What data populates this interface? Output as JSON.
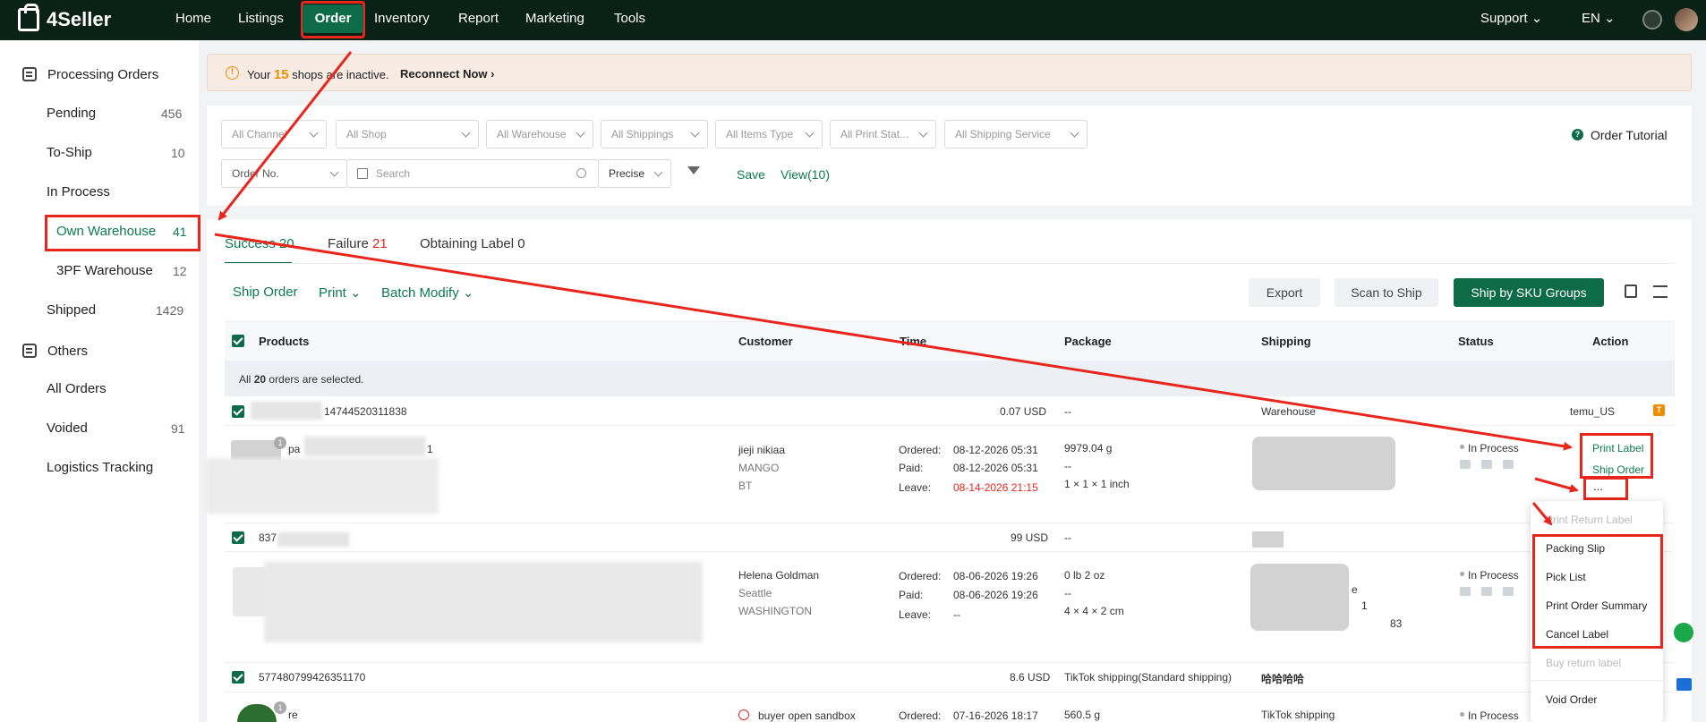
{
  "brand": "4Seller",
  "topnav": {
    "items": [
      "Home",
      "Listings",
      "Order",
      "Inventory",
      "Report",
      "Marketing",
      "Tools"
    ],
    "support": "Support",
    "language": "EN"
  },
  "sidebar": {
    "section1": "Processing Orders",
    "pending": {
      "label": "Pending",
      "count": "456"
    },
    "toship": {
      "label": "To-Ship",
      "count": "10"
    },
    "inprocess": {
      "label": "In Process"
    },
    "ownwh": {
      "label": "Own Warehouse",
      "count": "41"
    },
    "pfwh": {
      "label": "3PF Warehouse",
      "count": "12"
    },
    "shipped": {
      "label": "Shipped",
      "count": "1429"
    },
    "section2": "Others",
    "allorders": "All Orders",
    "voided": {
      "label": "Voided",
      "count": "91"
    },
    "logistics": "Logistics Tracking"
  },
  "notice": {
    "pre": "Your",
    "count": "15",
    "post": "shops are inactive.",
    "link": "Reconnect Now"
  },
  "filters": {
    "channel": "All Channel",
    "shop": "All Shop",
    "warehouse": "All Warehouse",
    "shippings": "All Shippings",
    "items_type": "All Items Type",
    "print_status": "All Print Stat...",
    "shipping_service": "All Shipping Service",
    "order_no": "Order No.",
    "search_placeholder": "Search",
    "precise": "Precise",
    "save": "Save",
    "view": "View(10)",
    "tutorial": "Order Tutorial"
  },
  "tabs": {
    "success_label": "Success",
    "success_count": "20",
    "failure_label": "Failure",
    "failure_count": "21",
    "obtaining_label": "Obtaining Label 0"
  },
  "toolbar": {
    "ship_order": "Ship Order",
    "print": "Print",
    "batch_modify": "Batch Modify",
    "export": "Export",
    "scan_to_ship": "Scan to Ship",
    "ship_by_sku": "Ship by SKU Groups"
  },
  "table": {
    "headers": [
      "Products",
      "Customer",
      "Time",
      "Package",
      "Shipping",
      "Status",
      "Action"
    ],
    "selected_pre": "All",
    "selected_count": "20",
    "selected_post": "orders are selected."
  },
  "orders": [
    {
      "order_no": "14744520311838",
      "amount": "0.07 USD",
      "package_head": "--",
      "shipping_head": "Warehouse",
      "shop": "temu_US",
      "shop_badge": "T",
      "product": "pa",
      "product_tail": "1",
      "customer_name": "jieji nikiaa",
      "customer_city": "MANGO",
      "customer_state": "BT",
      "ordered": "08-12-2026 05:31",
      "paid": "08-12-2026 05:31",
      "leave": "08-14-2026 21:15",
      "pkg_weight": "9979.04 g",
      "pkg_mid": "--",
      "pkg_dims": "1 × 1 × 1 inch",
      "status": "In Process",
      "action1": "Print Label",
      "action2": "Ship Order",
      "more": "..."
    },
    {
      "order_no": "837",
      "amount": "99 USD",
      "package_head": "--",
      "customer_name": "Helena Goldman",
      "customer_city": "Seattle",
      "customer_state": "WASHINGTON",
      "ordered": "08-06-2026 19:26",
      "paid": "08-06-2026 19:26",
      "leave": "--",
      "pkg_weight": "0 lb 2 oz",
      "pkg_mid": "--",
      "pkg_dims": "4 × 4 × 2 cm",
      "status": "In Process",
      "ship_frag1": "e",
      "ship_frag2": "1",
      "ship_frag3": "83"
    },
    {
      "order_no": "577480799426351170",
      "amount": "8.6 USD",
      "package_head": "TikTok shipping(Standard shipping)",
      "shipping_head": "哈哈哈哈",
      "product": "re",
      "customer_name": "buyer open sandbox",
      "ordered": "07-16-2026 18:17",
      "pkg_weight": "560.5 g",
      "shipping": "TikTok shipping",
      "status": "In Process"
    }
  ],
  "time_labels": {
    "ordered": "Ordered:",
    "paid": "Paid:",
    "leave": "Leave:"
  },
  "menu": {
    "items": [
      "Print Return Label",
      "Packing Slip",
      "Pick List",
      "Print Order Summary",
      "Cancel Label",
      "Buy return label",
      "Void Order"
    ]
  },
  "colors": {
    "nav_bg": "#0a2117",
    "accent": "#0d6b4a",
    "annotation": "#e8261d",
    "orange": "#f08c00"
  }
}
